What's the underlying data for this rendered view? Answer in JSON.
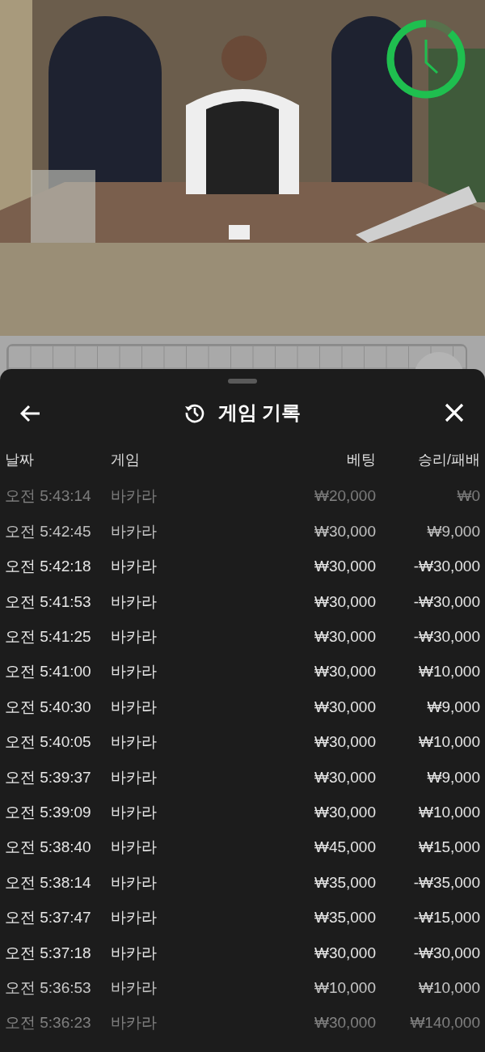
{
  "timer": {
    "level": 0.88
  },
  "sheet": {
    "title": "게임 기록"
  },
  "table": {
    "columns": [
      "날짜",
      "게임",
      "베팅",
      "승리/패배"
    ],
    "rows": [
      {
        "date": "오전 5:43:14",
        "game": "바카라",
        "bet": "₩20,000",
        "result": "₩0"
      },
      {
        "date": "오전 5:42:45",
        "game": "바카라",
        "bet": "₩30,000",
        "result": "₩9,000"
      },
      {
        "date": "오전 5:42:18",
        "game": "바카라",
        "bet": "₩30,000",
        "result": "-₩30,000"
      },
      {
        "date": "오전 5:41:53",
        "game": "바카라",
        "bet": "₩30,000",
        "result": "-₩30,000"
      },
      {
        "date": "오전 5:41:25",
        "game": "바카라",
        "bet": "₩30,000",
        "result": "-₩30,000"
      },
      {
        "date": "오전 5:41:00",
        "game": "바카라",
        "bet": "₩30,000",
        "result": "₩10,000"
      },
      {
        "date": "오전 5:40:30",
        "game": "바카라",
        "bet": "₩30,000",
        "result": "₩9,000"
      },
      {
        "date": "오전 5:40:05",
        "game": "바카라",
        "bet": "₩30,000",
        "result": "₩10,000"
      },
      {
        "date": "오전 5:39:37",
        "game": "바카라",
        "bet": "₩30,000",
        "result": "₩9,000"
      },
      {
        "date": "오전 5:39:09",
        "game": "바카라",
        "bet": "₩30,000",
        "result": "₩10,000"
      },
      {
        "date": "오전 5:38:40",
        "game": "바카라",
        "bet": "₩45,000",
        "result": "₩15,000"
      },
      {
        "date": "오전 5:38:14",
        "game": "바카라",
        "bet": "₩35,000",
        "result": "-₩35,000"
      },
      {
        "date": "오전 5:37:47",
        "game": "바카라",
        "bet": "₩35,000",
        "result": "-₩15,000"
      },
      {
        "date": "오전 5:37:18",
        "game": "바카라",
        "bet": "₩30,000",
        "result": "-₩30,000"
      },
      {
        "date": "오전 5:36:53",
        "game": "바카라",
        "bet": "₩10,000",
        "result": "₩10,000"
      },
      {
        "date": "오전 5:36:23",
        "game": "바카라",
        "bet": "₩30,000",
        "result": "₩140,000"
      }
    ]
  }
}
